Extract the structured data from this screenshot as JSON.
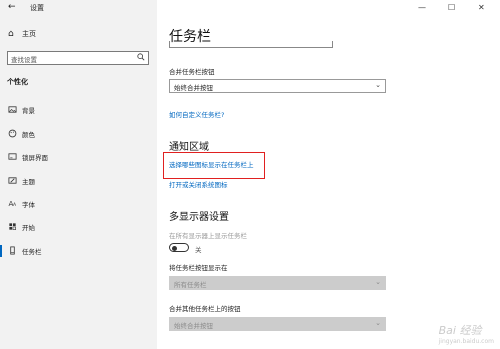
{
  "app": {
    "title": "设置",
    "back_icon": "back-arrow-icon"
  },
  "window_buttons": {
    "minimize": "—",
    "maximize": "☐",
    "close": "✕"
  },
  "sidebar": {
    "home_label": "主页",
    "search_placeholder": "查找设置",
    "section_title": "个性化",
    "items": [
      {
        "label": "背景",
        "icon": "image-icon"
      },
      {
        "label": "颜色",
        "icon": "palette-icon"
      },
      {
        "label": "锁屏界面",
        "icon": "lock-screen-icon"
      },
      {
        "label": "主题",
        "icon": "brush-icon"
      },
      {
        "label": "字体",
        "icon": "font-icon"
      },
      {
        "label": "开始",
        "icon": "start-icon"
      },
      {
        "label": "任务栏",
        "icon": "taskbar-icon",
        "active": true
      }
    ]
  },
  "main": {
    "title": "任务栏",
    "combine_label": "合并任务栏按钮",
    "combine_value": "始终合并按钮",
    "customize_link": "如何自定义任务栏?",
    "notification_heading": "通知区域",
    "select_icons_link": "选择哪些图标显示在任务栏上",
    "system_icons_link": "打开或关闭系统图标",
    "multi_display_heading": "多显示器设置",
    "show_all_label": "在所有显示器上显示任务栏",
    "toggle_state": "关",
    "show_buttons_label": "将任务栏按钮显示在",
    "show_buttons_value": "所有任务栏",
    "combine_other_label": "合并其他任务栏上的按钮",
    "combine_other_value": "始终合并按钮"
  },
  "colors": {
    "accent": "#0067c0",
    "highlight": "#e02020",
    "sidebar_bg": "#f2f2f2"
  },
  "watermark": {
    "text": "Bai 经验",
    "sub": "jingyan.baidu.com"
  }
}
